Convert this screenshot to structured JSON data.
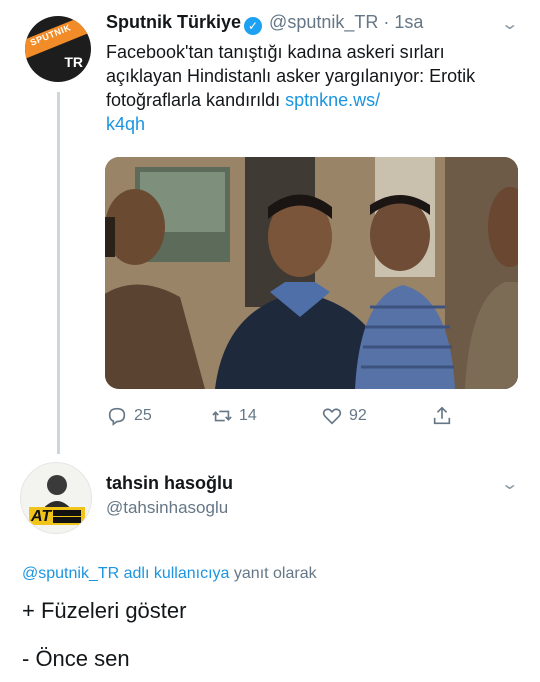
{
  "original_tweet": {
    "avatar": {
      "brand": "SPUTNIK",
      "region": "TR"
    },
    "author_name": "Sputnik Türkiye",
    "handle_time": "@sputnik_TR · 1sa",
    "text": "Facebook'tan tanıştığı kadına askeri sırları açıklayan Hindistanlı asker yargılanıyor: Erotik fotoğraflarla kandırıldı",
    "link_text": "sptnkne.ws/\nk4qh",
    "actions": {
      "reply_count": "25",
      "retweet_count": "14",
      "like_count": "92"
    }
  },
  "reply_tweet": {
    "author_name": "tahsin hasoğlu",
    "handle": "@tahsinhasoglu",
    "replying_mention": "@sputnik_TR adlı kullanıcıya",
    "replying_suffix": " yanıt olarak",
    "line1": "+ Füzeleri göster",
    "line2": "- Önce sen"
  },
  "colors": {
    "link": "#1b95e0",
    "muted": "#657786",
    "verified": "#1da1f2",
    "brand_orange": "#f28c28"
  }
}
